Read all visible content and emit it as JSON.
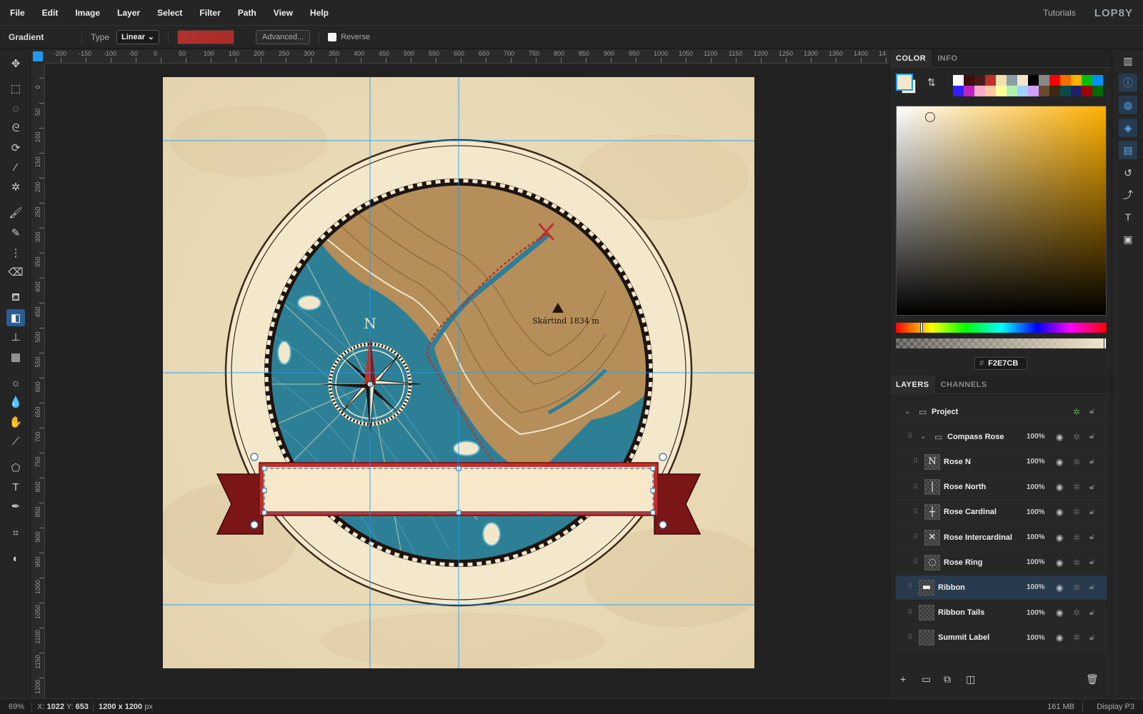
{
  "menubar": {
    "items": [
      "File",
      "Edit",
      "Image",
      "Layer",
      "Select",
      "Filter",
      "Path",
      "View",
      "Help"
    ],
    "tutorials": "Tutorials",
    "logo": "LOP8Y"
  },
  "options": {
    "tool_name": "Gradient",
    "type_label": "Type",
    "type_value": "Linear",
    "advanced_label": "Advanced...",
    "reverse_label": "Reverse",
    "gradient_color": "#b0302c"
  },
  "rulers": {
    "top": [
      "-200",
      "-150",
      "-100",
      "-50",
      "0",
      "50",
      "100",
      "150",
      "200",
      "250",
      "300",
      "350",
      "400",
      "450",
      "500",
      "550",
      "600",
      "650",
      "700",
      "750",
      "800",
      "850",
      "900",
      "950",
      "1000",
      "1050",
      "1100",
      "1150",
      "1200",
      "1250",
      "1300",
      "1350",
      "1400",
      "14"
    ],
    "left": [
      "0",
      "50",
      "100",
      "150",
      "200",
      "250",
      "300",
      "350",
      "400",
      "450",
      "500",
      "550",
      "600",
      "650",
      "700",
      "750",
      "800",
      "850",
      "900",
      "950",
      "1000",
      "1050",
      "1100",
      "1150",
      "1200"
    ]
  },
  "artwork": {
    "north_letter": "N",
    "summit_label": "Skártind 1834 m",
    "paper_color": "#f2e7cb",
    "sea_color": "#2d7f96",
    "land_color": "#b58e5a",
    "ribbon_color": "#c0302b",
    "ribbon_tail_color": "#7a1616"
  },
  "panel": {
    "color_tabs": [
      "COLOR",
      "INFO"
    ],
    "foreground_color": "#F2E7CB",
    "palette": [
      "#ffffff",
      "#3a0f0f",
      "#4a1a1a",
      "#c0302b",
      "#f0e0b0",
      "#8aa0a8",
      "#f2e7cb",
      "#000000",
      "#888888",
      "#ff0000",
      "#ff6a00",
      "#ffb000",
      "#00c000",
      "#0090ff",
      "#3020ff",
      "#c020c0",
      "#ffaac8",
      "#ffc8a0",
      "#ffff99",
      "#b0f0b0",
      "#a0d0ff",
      "#d0a0ff",
      "#6a4a2a",
      "#3a2a10",
      "#0a4a4a",
      "#20206a",
      "#a00000",
      "#006a00"
    ],
    "hex_hash": "#",
    "hex_value": "F2E7CB",
    "hue": 42,
    "layer_tabs": [
      "LAYERS",
      "CHANNELS"
    ],
    "layers": [
      {
        "name": "Project",
        "opacity": "",
        "kind": "folder",
        "depth": 0,
        "thumb": ""
      },
      {
        "name": "Compass Rose",
        "opacity": "100%",
        "kind": "folder",
        "depth": 1,
        "thumb": ""
      },
      {
        "name": "Rose N",
        "opacity": "100%",
        "kind": "layer",
        "depth": 2,
        "thumb": "N"
      },
      {
        "name": "Rose North",
        "opacity": "100%",
        "kind": "layer",
        "depth": 2,
        "thumb": "│"
      },
      {
        "name": "Rose Cardinal",
        "opacity": "100%",
        "kind": "layer",
        "depth": 2,
        "thumb": "┼"
      },
      {
        "name": "Rose Intercardinal",
        "opacity": "100%",
        "kind": "layer",
        "depth": 2,
        "thumb": "✕"
      },
      {
        "name": "Rose Ring",
        "opacity": "100%",
        "kind": "layer",
        "depth": 2,
        "thumb": "◌"
      },
      {
        "name": "Ribbon",
        "opacity": "100%",
        "kind": "layer",
        "depth": 1,
        "thumb": "▬",
        "selected": true
      },
      {
        "name": "Ribbon Tails",
        "opacity": "100%",
        "kind": "layer",
        "depth": 1,
        "thumb": ""
      },
      {
        "name": "Summit Label",
        "opacity": "100%",
        "kind": "layer",
        "depth": 1,
        "thumb": ""
      }
    ]
  },
  "status": {
    "zoom": "69%",
    "x_label": "X:",
    "x_value": "1022",
    "y_label": "Y:",
    "y_value": "653",
    "dims": "1200 x 1200",
    "dims_unit": "px",
    "memory": "161 MB",
    "profile": "Display P3"
  }
}
